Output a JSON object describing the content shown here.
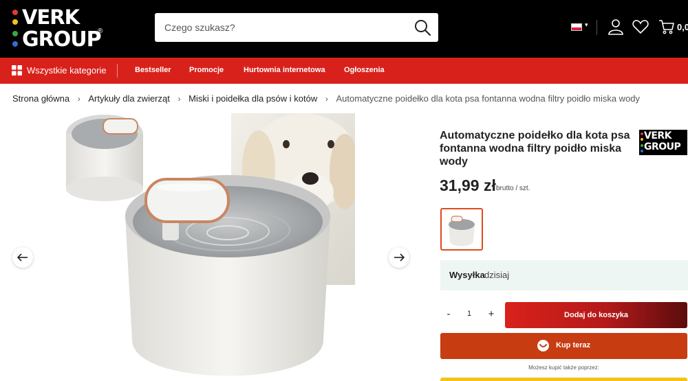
{
  "header": {
    "logo_line1": "VERK",
    "logo_line2": "GROUP",
    "logo_reg": "®",
    "search_placeholder": "Czego szukasz?",
    "cart_value": "0,0"
  },
  "nav": {
    "all_categories": "Wszystkie kategorie",
    "items": [
      "Bestseller",
      "Promocje",
      "Hurtownia internetowa",
      "Ogłoszenia"
    ]
  },
  "breadcrumb": {
    "items": [
      "Strona główna",
      "Artykuły dla zwierząt",
      "Miski i poidełka dla psów i kotów",
      "Automatyczne poidełko dla kota psa fontanna wodna filtry poidło miska wody"
    ]
  },
  "product": {
    "title": "Automatyczne poidełko dla kota psa fontanna wodna filtry poidło miska wody",
    "brand_line1": "VERK",
    "brand_line2": "GROUP",
    "price": "31,99 zł",
    "price_note": "brutto / szt.",
    "shipping_label": "Wysyłka",
    "shipping_value": "dzisiaj",
    "qty_minus": "-",
    "qty_value": "1",
    "qty_plus": "+",
    "add_to_cart": "Dodaj do koszyka",
    "buy_now": "Kup teraz",
    "pay_note": "Możesz kupić także poprzez:"
  },
  "colors": {
    "header_bg": "#000000",
    "nav_red": "#d9211b",
    "buy_now": "#c83c12",
    "shipping_bg": "#eef6f3",
    "thumb_border": "#e0491f"
  },
  "icons": [
    "search-icon",
    "user-icon",
    "heart-icon",
    "cart-icon",
    "grid-icon",
    "arrow-left-icon",
    "arrow-right-icon",
    "chevron-right-icon"
  ]
}
